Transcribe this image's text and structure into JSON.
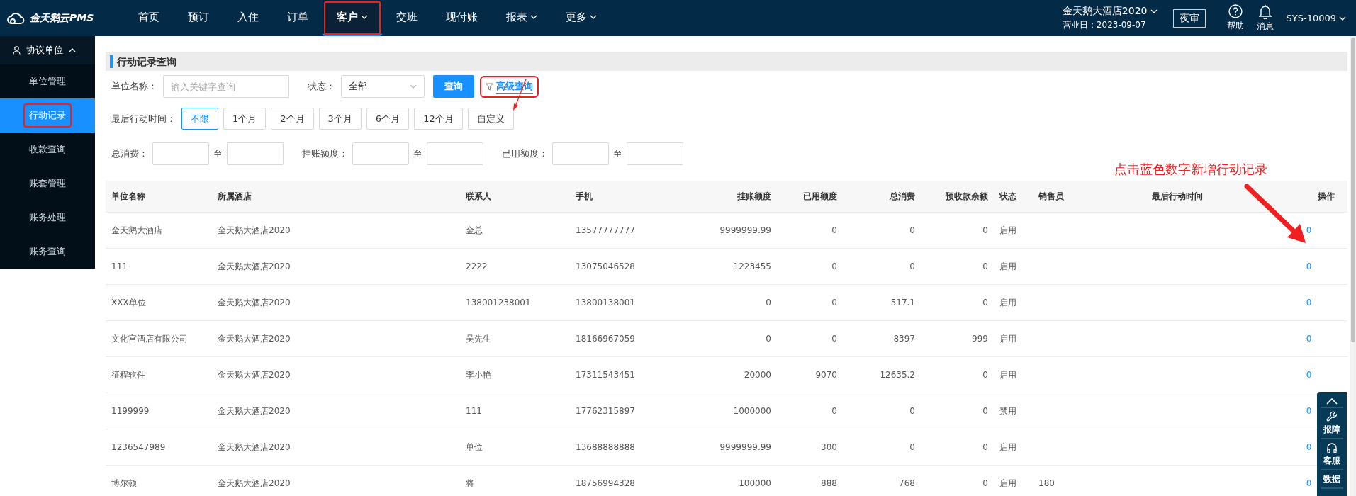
{
  "app": {
    "logo": "金天鹅云PMS"
  },
  "nav": [
    {
      "label": "首页",
      "selected": false,
      "dropdown": false,
      "highlighted": false
    },
    {
      "label": "预订",
      "selected": false,
      "dropdown": false,
      "highlighted": false
    },
    {
      "label": "入住",
      "selected": false,
      "dropdown": false,
      "highlighted": false
    },
    {
      "label": "订单",
      "selected": false,
      "dropdown": false,
      "highlighted": false
    },
    {
      "label": "客户",
      "selected": true,
      "dropdown": true,
      "highlighted": true
    },
    {
      "label": "交班",
      "selected": false,
      "dropdown": false,
      "highlighted": false
    },
    {
      "label": "现付账",
      "selected": false,
      "dropdown": false,
      "highlighted": false
    },
    {
      "label": "报表",
      "selected": false,
      "dropdown": true,
      "highlighted": false
    },
    {
      "label": "更多",
      "selected": false,
      "dropdown": true,
      "highlighted": false
    }
  ],
  "header_right": {
    "hotel": "金天鹅大酒店2020",
    "business_date": "营业日：2023-09-07",
    "night_audit": "夜审",
    "help": "帮助",
    "messages": "消息",
    "user": "SYS-10009"
  },
  "sidebar": {
    "group": "协议单位",
    "expanded": true,
    "items": [
      {
        "label": "单位管理",
        "selected": false,
        "highlighted": false
      },
      {
        "label": "行动记录",
        "selected": true,
        "highlighted": true
      },
      {
        "label": "收款查询",
        "selected": false,
        "highlighted": false
      },
      {
        "label": "账套管理",
        "selected": false,
        "highlighted": false
      },
      {
        "label": "账务处理",
        "selected": false,
        "highlighted": false
      },
      {
        "label": "账务查询",
        "selected": false,
        "highlighted": false
      }
    ]
  },
  "page_title": "行动记录查询",
  "filters": {
    "name_label": "单位名称：",
    "name_placeholder": "输入关键字查询",
    "status_label": "状态：",
    "status_value": "全部",
    "query_button": "查询",
    "advanced_query": "高级查询",
    "advanced_highlighted": true,
    "time_label": "最后行动时间：",
    "time_options": [
      {
        "label": "不限",
        "selected": true
      },
      {
        "label": "1个月",
        "selected": false
      },
      {
        "label": "2个月",
        "selected": false
      },
      {
        "label": "3个月",
        "selected": false
      },
      {
        "label": "6个月",
        "selected": false
      },
      {
        "label": "12个月",
        "selected": false
      },
      {
        "label": "自定义",
        "selected": false
      }
    ],
    "ranges": [
      {
        "label": "总消费：",
        "to": "至"
      },
      {
        "label": "挂账额度：",
        "to": "至"
      },
      {
        "label": "已用额度：",
        "to": "至"
      }
    ]
  },
  "table": {
    "columns": [
      "单位名称",
      "所属酒店",
      "联系人",
      "手机",
      "挂账额度",
      "已用额度",
      "总消费",
      "预收款余额",
      "状态",
      "销售员",
      "最后行动时间",
      "操作"
    ],
    "rows": [
      {
        "name": "金天鹅大酒店",
        "hotel": "金天鹅大酒店2020",
        "contact": "金总",
        "phone": "13577777777",
        "credit_limit": "9999999.99",
        "used_amount": "0",
        "total_spend": "0",
        "prepaid_balance": "0",
        "status": "启用",
        "operation": "0"
      },
      {
        "name": "111",
        "hotel": "金天鹅大酒店2020",
        "contact": "2222",
        "phone": "13075046528",
        "credit_limit": "1223455",
        "used_amount": "0",
        "total_spend": "0",
        "prepaid_balance": "0",
        "status": "启用",
        "operation": "0"
      },
      {
        "name": "XXX单位",
        "hotel": "金天鹅大酒店2020",
        "contact": "138001238001",
        "phone": "13800138001",
        "credit_limit": "0",
        "used_amount": "0",
        "total_spend": "517.1",
        "prepaid_balance": "0",
        "status": "启用",
        "operation": "0"
      },
      {
        "name": "文化宫酒店有限公司",
        "hotel": "金天鹅大酒店2020",
        "contact": "吴先生",
        "phone": "18166967059",
        "credit_limit": "0",
        "used_amount": "0",
        "total_spend": "8397",
        "prepaid_balance": "999",
        "status": "启用",
        "operation": "0"
      },
      {
        "name": "征程软件",
        "hotel": "金天鹅大酒店2020",
        "contact": "李小艳",
        "phone": "17311543451",
        "credit_limit": "20000",
        "used_amount": "9070",
        "total_spend": "12635.2",
        "prepaid_balance": "0",
        "status": "启用",
        "operation": "0"
      },
      {
        "name": "1199999",
        "hotel": "金天鹅大酒店2020",
        "contact": "111",
        "phone": "17762315897",
        "credit_limit": "1000000",
        "used_amount": "0",
        "total_spend": "0",
        "prepaid_balance": "0",
        "status": "禁用",
        "operation": "0"
      },
      {
        "name": "1236547989",
        "hotel": "金天鹅大酒店2020",
        "contact": "单位",
        "phone": "13688888888",
        "credit_limit": "9999999.99",
        "used_amount": "300",
        "total_spend": "0",
        "prepaid_balance": "0",
        "status": "启用",
        "operation": "0"
      },
      {
        "name": "博尔顿",
        "hotel": "金天鹅大酒店2020",
        "contact": "将",
        "phone": "18756994328",
        "credit_limit": "100000",
        "used_amount": "888",
        "total_spend": "768",
        "prepaid_balance": "0",
        "status": "启用",
        "salesperson": "180",
        "operation": "0"
      }
    ]
  },
  "annotation": {
    "text": "点击蓝色数字新增行动记录"
  },
  "float_panel": {
    "items": [
      {
        "kind": "top"
      },
      {
        "kind": "wrench",
        "label": "报障"
      },
      {
        "kind": "headset",
        "label": "客服"
      },
      {
        "kind": "text",
        "label": "数据"
      }
    ]
  }
}
